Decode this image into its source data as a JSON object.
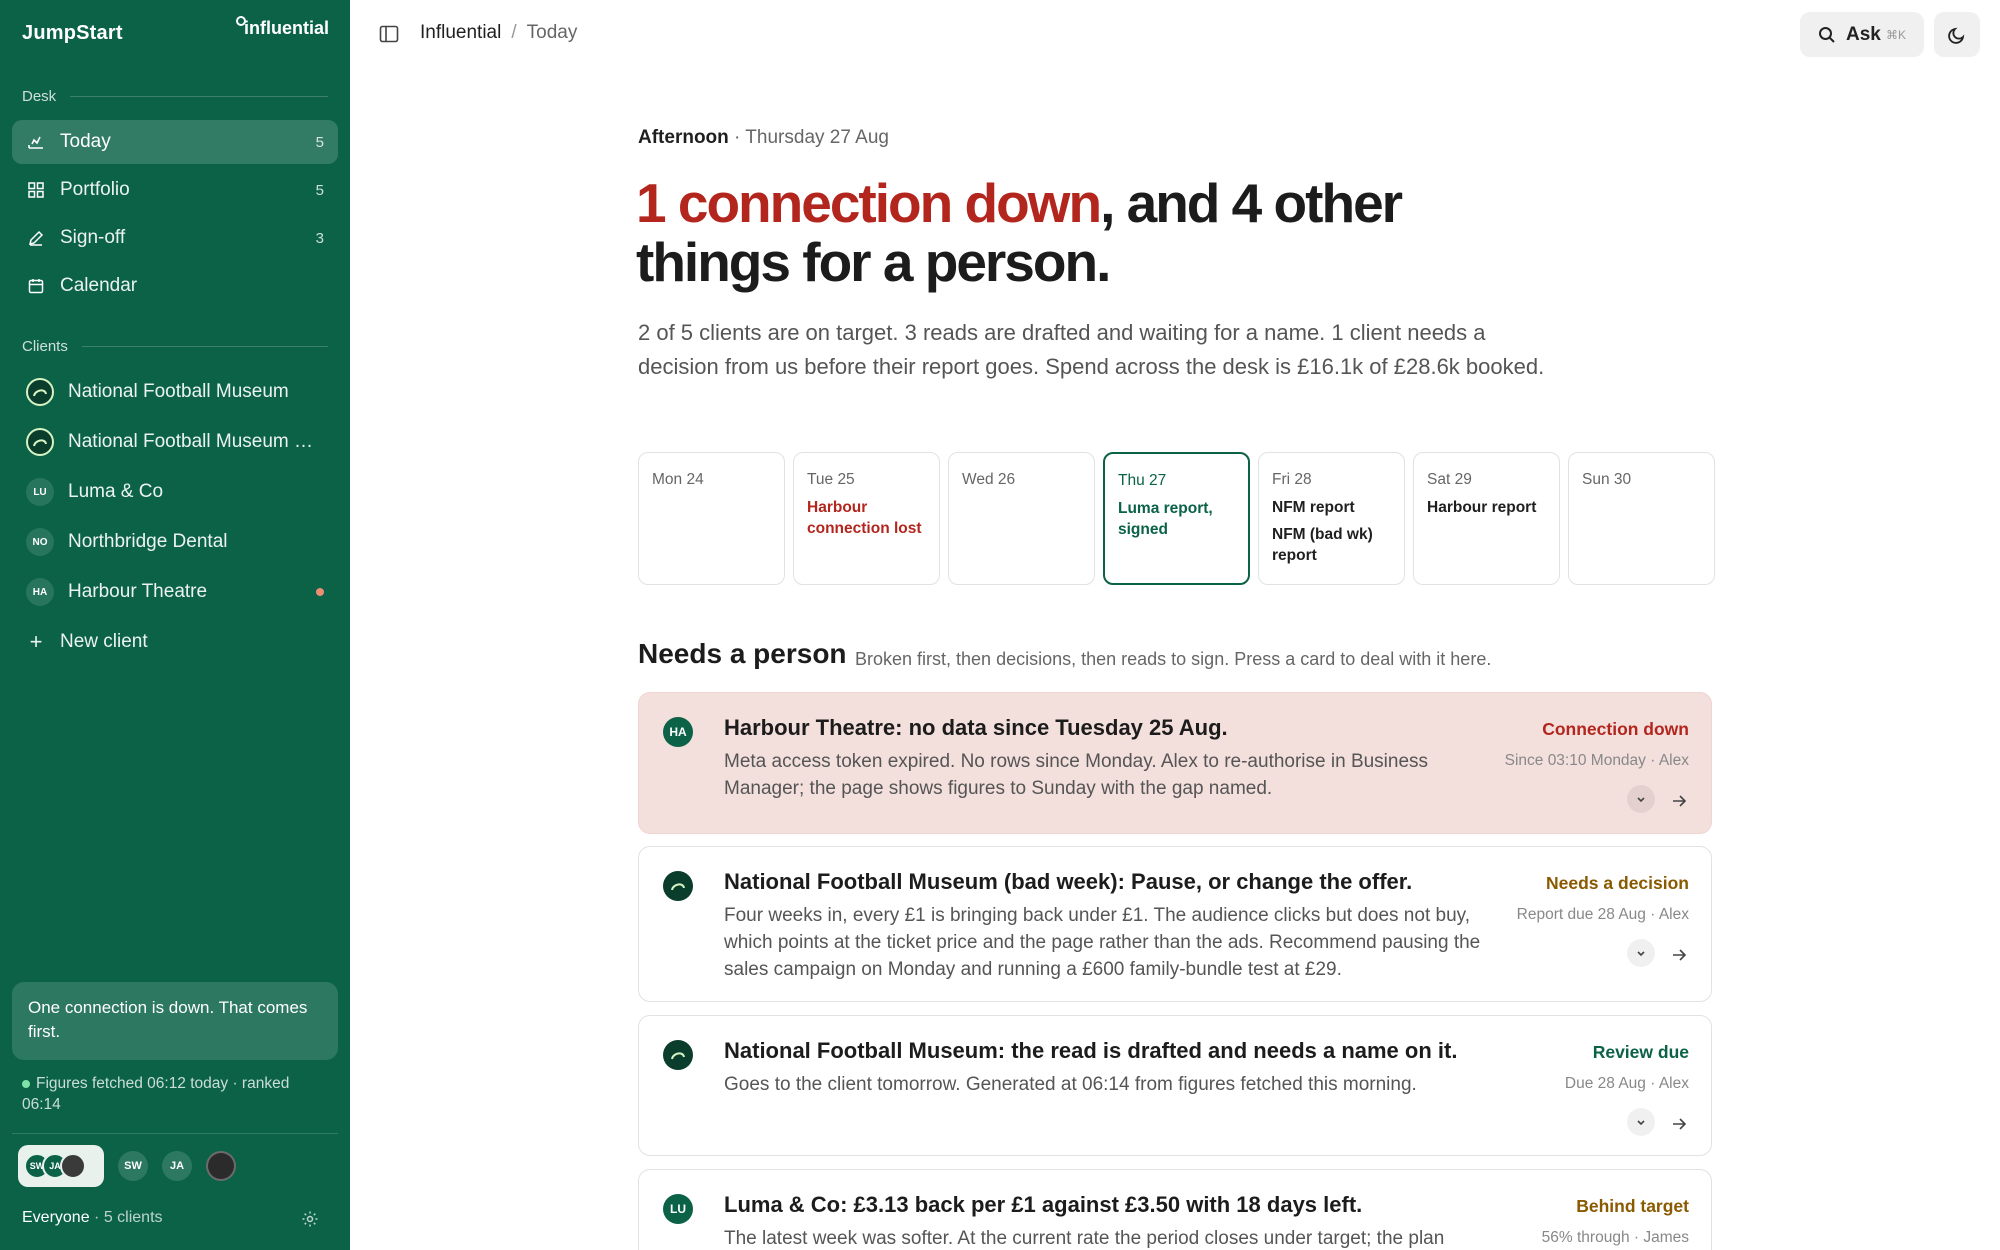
{
  "app": {
    "name": "JumpStart",
    "logo_text": "influential"
  },
  "sidebar": {
    "desk_label": "Desk",
    "nav": [
      {
        "label": "Today",
        "count": "5",
        "icon": "today-icon"
      },
      {
        "label": "Portfolio",
        "count": "5",
        "icon": "grid-icon"
      },
      {
        "label": "Sign-off",
        "count": "3",
        "icon": "pen-icon"
      },
      {
        "label": "Calendar",
        "count": "",
        "icon": "calendar-icon"
      }
    ],
    "clients_label": "Clients",
    "clients": [
      {
        "label": "National Football Museum",
        "badge": ""
      },
      {
        "label": "National Football Museum (bad week)",
        "badge": ""
      },
      {
        "label": "Luma & Co",
        "badge": "LU"
      },
      {
        "label": "Northbridge Dental",
        "badge": "NO"
      },
      {
        "label": "Harbour Theatre",
        "badge": "HA"
      }
    ],
    "new_client": "New client",
    "notice": "One connection is down. That comes first.",
    "fetched": "Figures fetched 06:12 today · ranked 06:14",
    "avatars": {
      "group": [
        "SW",
        "JA"
      ],
      "single": [
        "SW",
        "JA"
      ]
    },
    "scope": "Everyone",
    "scope_detail": "· 5 clients"
  },
  "topbar": {
    "crumb_root": "Influential",
    "crumb_sep": "/",
    "crumb_current": "Today",
    "ask_label": "Ask",
    "ask_kbd": "⌘K"
  },
  "main": {
    "greeting": "Afternoon",
    "date": "· Thursday 27 Aug",
    "headline_red": "1 connection down",
    "headline_rest": ", and 4 other things for a person.",
    "summary": "2 of 5 clients are on target. 3 reads are drafted and waiting for a name. 1 client needs a decision from us before their report goes. Spend across the desk is £16.1k of £28.6k booked.",
    "days": [
      {
        "name": "Mon 24",
        "events": []
      },
      {
        "name": "Tue 25",
        "events": [
          {
            "text": "Harbour connection lost",
            "tone": "red"
          }
        ]
      },
      {
        "name": "Wed 26",
        "events": []
      },
      {
        "name": "Thu 27",
        "events": [
          {
            "text": "Luma report, signed",
            "tone": "green"
          }
        ],
        "today": true
      },
      {
        "name": "Fri 28",
        "events": [
          {
            "text": "NFM report",
            "tone": ""
          },
          {
            "text": "NFM (bad wk) report",
            "tone": ""
          }
        ]
      },
      {
        "name": "Sat 29",
        "events": [
          {
            "text": "Harbour report",
            "tone": ""
          }
        ]
      },
      {
        "name": "Sun 30",
        "events": []
      }
    ],
    "needs_title": "Needs a person",
    "needs_sub": "Broken first, then decisions, then reads to sign. Press a card to deal with it here.",
    "cards": [
      {
        "badge": "HA",
        "title": "Harbour Theatre: no data since Tuesday 25 Aug.",
        "body": "Meta access token expired. No rows since Monday. Alex to re-authorise in Business Manager; the page shows figures to Sunday with the gap named.",
        "status": "Connection down",
        "meta": "Since 03:10 Monday · Alex"
      },
      {
        "badge": "",
        "title": "National Football Museum (bad week): Pause, or change the offer.",
        "body": "Four weeks in, every £1 is bringing back under £1. The audience clicks but does not buy, which points at the ticket price and the page rather than the ads. Recommend pausing the sales campaign on Monday and running a £600 family-bundle test at £29.",
        "status": "Needs a decision",
        "meta": "Report due 28 Aug · Alex"
      },
      {
        "badge": "",
        "title": "National Football Museum: the read is drafted and needs a name on it.",
        "body": "Goes to the client tomorrow. Generated at 06:14 from figures fetched this morning.",
        "status": "Review due",
        "meta": "Due 28 Aug · Alex"
      },
      {
        "badge": "LU",
        "title": "Luma & Co: £3.13 back per £1 against £3.50 with 18 days left.",
        "body": "The latest week was softer. At the current rate the period closes under target; the plan",
        "status": "Behind target",
        "meta": "56% through · James"
      }
    ]
  },
  "colors": {
    "sidebar": "#0b6247",
    "danger": "#b3261e",
    "amber": "#8a5a00",
    "danger_bg": "#f3dfdc"
  }
}
